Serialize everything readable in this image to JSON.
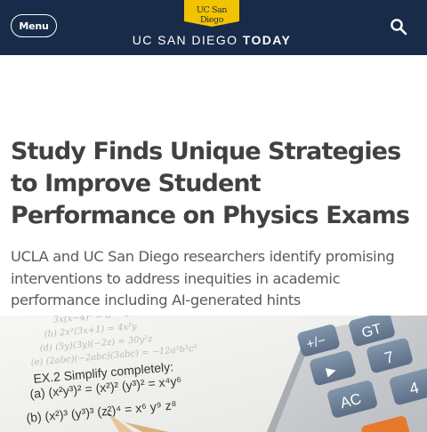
{
  "header": {
    "menu_label": "Menu",
    "logo_text": "UC San Diego",
    "site_title_regular": "UC SAN DIEGO ",
    "site_title_bold": "TODAY",
    "search_icon": "search-icon",
    "colors": {
      "navy": "#182b49",
      "gold": "#f3c300"
    }
  },
  "article": {
    "title": "Study Finds Unique Strategies to Improve Student Performance on Physics Exams",
    "subtitle": "UCLA and UC San Diego researchers identify promising interventions to address inequities in academic performance including AI-generated hints"
  },
  "hero": {
    "paper_lines": [
      "EX.2 Simplify completely:",
      "(a) (x²y³)² = (x²)² (y³)² = x⁴y⁶",
      "(b) (x²)³ (y³)³ (z²)⁴ = x⁶ y⁹ z⁸"
    ],
    "calculator_keys": [
      "+/−",
      "GT",
      "▶",
      "7",
      "AC",
      "4"
    ]
  }
}
